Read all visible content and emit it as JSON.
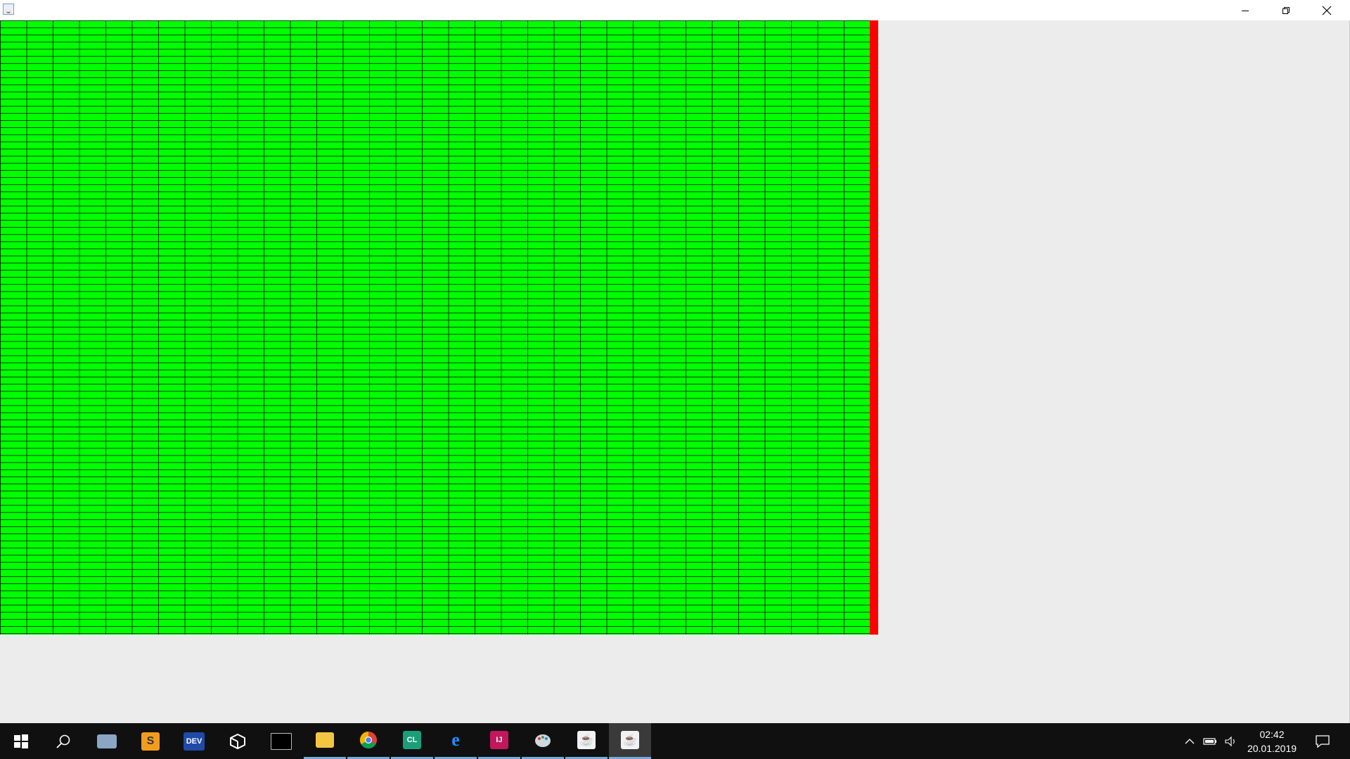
{
  "window": {
    "icon": "java-cup-icon",
    "controls": [
      "minimize-icon",
      "restore-icon",
      "close-icon"
    ]
  },
  "canvas": {
    "fill_color": "#00ff00",
    "grid_line_color": "#0a3a0a",
    "bar_color": "#ff0000",
    "background": "#ececec"
  },
  "taskbar": {
    "items": [
      {
        "name": "start-windows-icon"
      },
      {
        "name": "search-icon"
      },
      {
        "name": "task-view-icon"
      },
      {
        "name": "sublime-text-icon"
      },
      {
        "name": "devcpp-icon",
        "label": "DEV"
      },
      {
        "name": "unity-icon"
      },
      {
        "name": "terminal-icon"
      },
      {
        "name": "file-explorer-icon"
      },
      {
        "name": "chrome-icon"
      },
      {
        "name": "clion-icon",
        "label": "CL"
      },
      {
        "name": "edge-icon",
        "label": "e"
      },
      {
        "name": "intellij-icon",
        "label": "IJ"
      },
      {
        "name": "paint-icon"
      },
      {
        "name": "java-icon"
      },
      {
        "name": "java-app-icon"
      }
    ],
    "tray": {
      "time": "02:42",
      "date": "20.01.2019"
    }
  }
}
